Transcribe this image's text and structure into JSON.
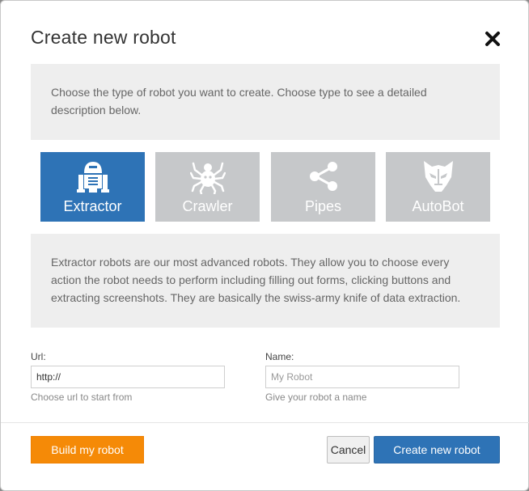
{
  "dialog": {
    "title": "Create new robot"
  },
  "intro_text": "Choose the type of robot you want to create. Choose type to see a detailed description below.",
  "robot_types": [
    {
      "label": "Extractor",
      "icon": "r2d2-robot-icon",
      "selected": true
    },
    {
      "label": "Crawler",
      "icon": "spider-icon",
      "selected": false
    },
    {
      "label": "Pipes",
      "icon": "share-nodes-icon",
      "selected": false
    },
    {
      "label": "AutoBot",
      "icon": "autobot-mask-icon",
      "selected": false
    }
  ],
  "description_text": "Extractor robots are our most advanced robots. They allow you to choose every action the robot needs to perform including filling out forms, clicking buttons and extracting screenshots. They are basically the swiss-army knife of data extraction.",
  "form": {
    "url": {
      "label": "Url:",
      "value": "http://",
      "help": "Choose url to start from"
    },
    "name": {
      "label": "Name:",
      "placeholder": "My Robot",
      "help": "Give your robot a name"
    }
  },
  "footer": {
    "build_label": "Build my robot",
    "cancel_label": "Cancel",
    "create_label": "Create new robot"
  },
  "colors": {
    "primary": "#2e73b6",
    "orange": "#f58a07",
    "inactive_tile": "#c6c8ca",
    "panel": "#eeeeee"
  }
}
